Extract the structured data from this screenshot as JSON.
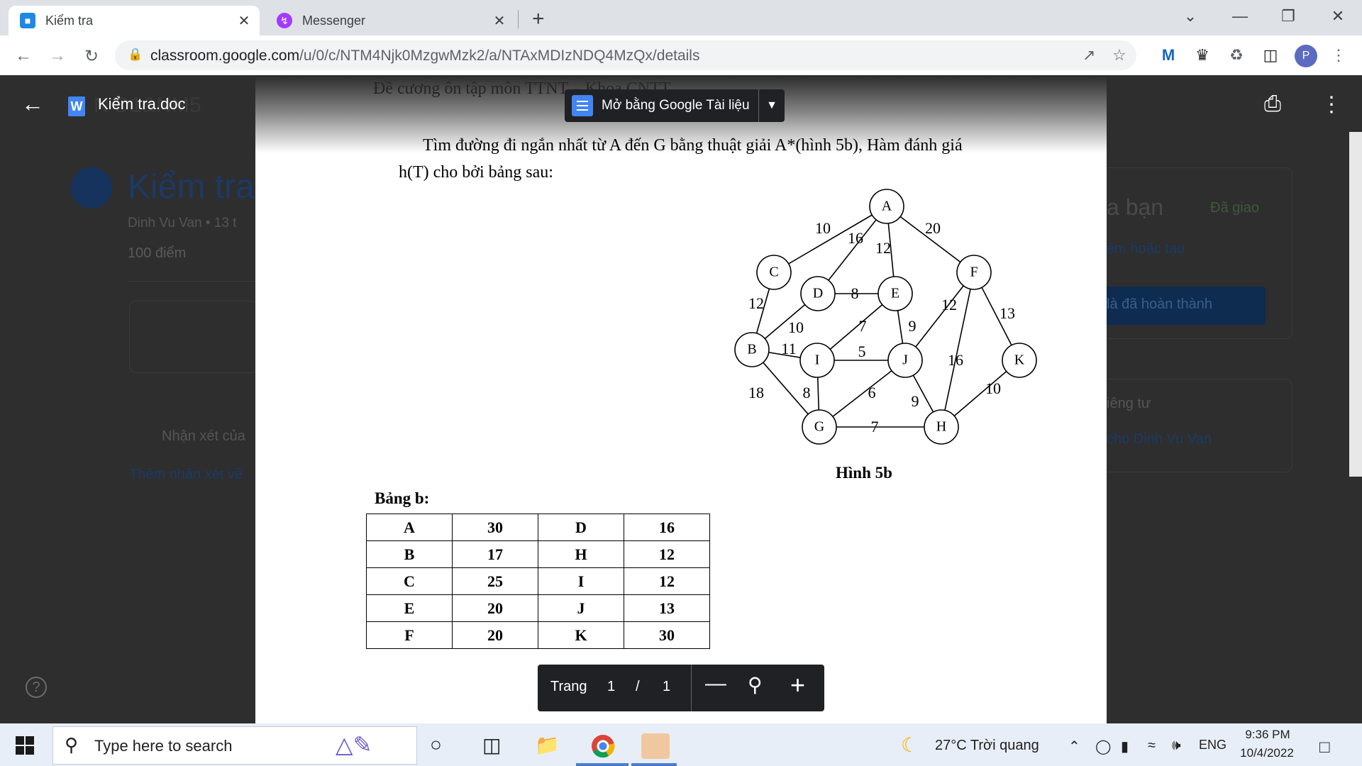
{
  "browser": {
    "tabs": [
      {
        "title": "Kiểm tra",
        "active": true
      },
      {
        "title": "Messenger",
        "active": false
      }
    ],
    "url_host": "classroom.google.com",
    "url_path": "/u/0/c/NTM4Njk0MzgwMzk2/a/NTAxMDIzNDQ4MzQx/details",
    "profile_initial": "P"
  },
  "classroom_bg": {
    "header_fragment": "N Đ1&NM5",
    "title": "Kiểm tra",
    "author": "Dinh Vu Van • 13 t",
    "points": "100 điểm",
    "comments_label": "Nhận xét của",
    "add_comment": "Thêm nhận xét về",
    "your_work_fragment": "a bạn",
    "assigned": "Đã giao",
    "add_or_create": "êm hoặc tạo",
    "mark_done": "là đã hoàn thành",
    "private_fragment": "iêng tư",
    "private_to": "cho Dinh Vu Van"
  },
  "viewer": {
    "file_name": "Kiểm tra.doc",
    "open_with": "Mở bằng Google Tài liệu",
    "page_label": "Trang",
    "current_page": "1",
    "page_sep": "/",
    "total_pages": "1"
  },
  "document": {
    "header": "Đề cương ôn tập môn TTNT – Khoa CNTT",
    "problem_line1": "Tìm đường đi ngắn nhất từ A đến G bằng thuật giải A*(hình 5b), Hàm đánh giá",
    "problem_line2": "h(T) cho bởi bảng sau:",
    "figure_caption": "Hình 5b",
    "table_caption": "Bảng b:",
    "table_rows": [
      [
        "A",
        "30",
        "D",
        "16"
      ],
      [
        "B",
        "17",
        "H",
        "12"
      ],
      [
        "C",
        "25",
        "I",
        "12"
      ],
      [
        "E",
        "20",
        "J",
        "13"
      ],
      [
        "F",
        "20",
        "K",
        "30"
      ]
    ],
    "graph": {
      "nodes": [
        "A",
        "B",
        "C",
        "D",
        "E",
        "F",
        "G",
        "H",
        "I",
        "J",
        "K"
      ],
      "edges": [
        {
          "from": "A",
          "to": "C",
          "w": "10"
        },
        {
          "from": "A",
          "to": "D",
          "w": "16"
        },
        {
          "from": "A",
          "to": "E",
          "w": "12"
        },
        {
          "from": "A",
          "to": "F",
          "w": "20"
        },
        {
          "from": "C",
          "to": "B",
          "w": "12"
        },
        {
          "from": "D",
          "to": "E",
          "w": "8"
        },
        {
          "from": "D",
          "to": "B",
          "w": "10"
        },
        {
          "from": "E",
          "to": "I",
          "w": "7"
        },
        {
          "from": "E",
          "to": "J",
          "w": "9"
        },
        {
          "from": "F",
          "to": "J",
          "w": "12"
        },
        {
          "from": "F",
          "to": "K",
          "w": "13"
        },
        {
          "from": "F",
          "to": "H",
          "w": "16"
        },
        {
          "from": "B",
          "to": "I",
          "w": "11"
        },
        {
          "from": "I",
          "to": "J",
          "w": "5"
        },
        {
          "from": "B",
          "to": "G",
          "w": "18"
        },
        {
          "from": "I",
          "to": "G",
          "w": "8"
        },
        {
          "from": "G",
          "to": "J",
          "w": "6"
        },
        {
          "from": "J",
          "to": "H",
          "w": "9"
        },
        {
          "from": "G",
          "to": "H",
          "w": "7"
        },
        {
          "from": "K",
          "to": "H",
          "w": "10"
        }
      ]
    }
  },
  "taskbar": {
    "search_placeholder": "Type here to search",
    "weather": "27°C  Trời quang",
    "lang": "ENG",
    "time": "9:36 PM",
    "date": "10/4/2022"
  }
}
